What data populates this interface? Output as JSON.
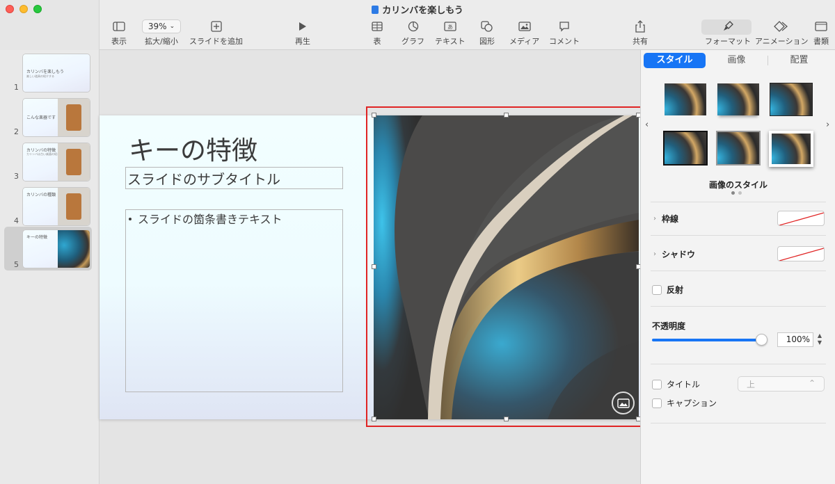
{
  "window": {
    "title": "カリンバを楽しもう"
  },
  "toolbar": {
    "view": "表示",
    "zoom_value": "39%",
    "zoom_label": "拡大/縮小",
    "add_slide": "スライドを追加",
    "play": "再生",
    "table": "表",
    "chart": "グラフ",
    "text": "テキスト",
    "shape": "図形",
    "media": "メディア",
    "comment": "コメント",
    "share": "共有",
    "format": "フォーマット",
    "animate": "アニメーション",
    "document": "書類"
  },
  "navigator": {
    "slides": [
      {
        "num": "1",
        "title": "カリンバを楽しもう",
        "sub": "楽しい道具の紹介する"
      },
      {
        "num": "2",
        "title": "こんな楽器です",
        "sub": ""
      },
      {
        "num": "3",
        "title": "カリンバの特徴",
        "sub": "カリンバは古い楽器の紹介する"
      },
      {
        "num": "4",
        "title": "カリンバの種類",
        "sub": ""
      },
      {
        "num": "5",
        "title": "キーの特徴",
        "sub": ""
      }
    ]
  },
  "slide": {
    "title": "キーの特徴",
    "subtitle": "スライドのサブタイトル",
    "bullet": "スライドの箇条書きテキスト"
  },
  "inspector": {
    "tabs": [
      "スタイル",
      "画像",
      "配置"
    ],
    "styles_label": "画像のスタイル",
    "border_label": "枠線",
    "shadow_label": "シャドウ",
    "reflection_label": "反射",
    "opacity_label": "不透明度",
    "opacity_value": "100%",
    "opacity_fraction": 1.0,
    "title_label": "タイトル",
    "title_position": "上",
    "caption_label": "キャプション"
  },
  "colors": {
    "accent": "#1775f5",
    "selection_frame": "#e02424"
  }
}
